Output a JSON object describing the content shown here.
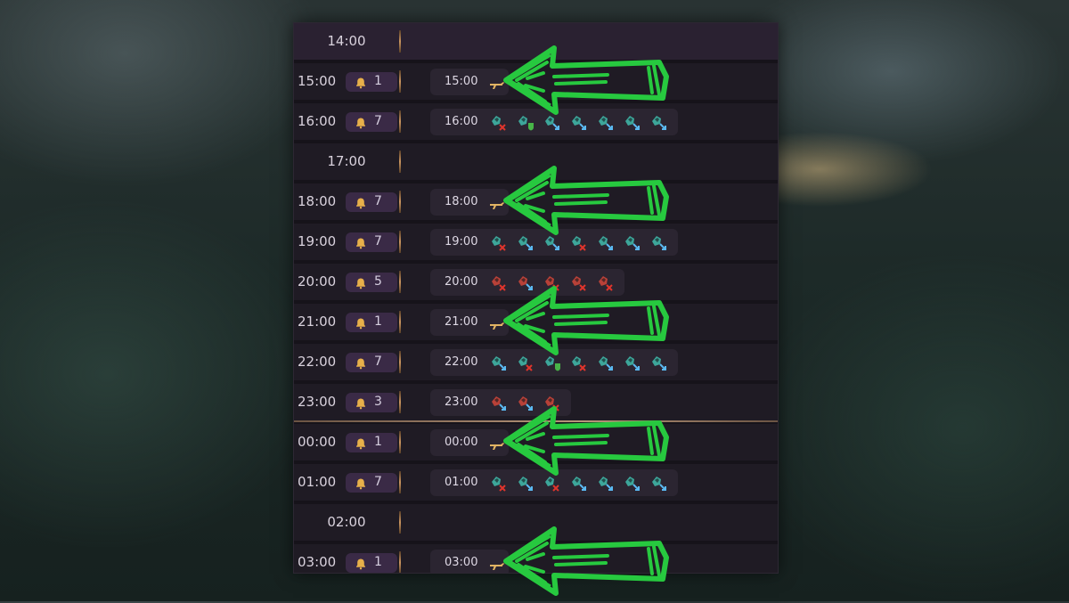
{
  "rows": [
    {
      "time": "14:00",
      "kind": "header"
    },
    {
      "time": "15:00",
      "count": "1",
      "card_time": "15:00",
      "rifle": true,
      "icons": []
    },
    {
      "time": "16:00",
      "count": "7",
      "card_time": "16:00",
      "rifle": false,
      "icons": [
        "teal-x",
        "teal-shield",
        "teal-arrow",
        "teal-arrow",
        "teal-arrow",
        "teal-arrow",
        "teal-arrow"
      ]
    },
    {
      "time": "17:00",
      "kind": "empty"
    },
    {
      "time": "18:00",
      "count": "7",
      "card_time": "18:00",
      "rifle": true,
      "icons": []
    },
    {
      "time": "19:00",
      "count": "7",
      "card_time": "19:00",
      "rifle": false,
      "icons": [
        "teal-x",
        "teal-arrow",
        "teal-arrow",
        "teal-x",
        "teal-arrow",
        "teal-arrow",
        "teal-arrow"
      ]
    },
    {
      "time": "20:00",
      "count": "5",
      "card_time": "20:00",
      "rifle": false,
      "icons": [
        "red-x",
        "red-arrow",
        "red-x",
        "red-x",
        "red-x"
      ]
    },
    {
      "time": "21:00",
      "count": "1",
      "card_time": "21:00",
      "rifle": true,
      "icons": []
    },
    {
      "time": "22:00",
      "count": "7",
      "card_time": "22:00",
      "rifle": false,
      "icons": [
        "teal-arrow",
        "teal-x",
        "teal-shield",
        "teal-x",
        "teal-arrow",
        "teal-arrow",
        "teal-arrow"
      ]
    },
    {
      "time": "23:00",
      "count": "3",
      "card_time": "23:00",
      "rifle": false,
      "icons": [
        "red-arrow",
        "red-arrow",
        "red-x"
      ]
    },
    {
      "time": "00:00",
      "count": "1",
      "card_time": "00:00",
      "rifle": true,
      "icons": []
    },
    {
      "time": "01:00",
      "count": "7",
      "card_time": "01:00",
      "rifle": false,
      "icons": [
        "teal-x",
        "teal-arrow",
        "teal-x",
        "teal-arrow",
        "teal-arrow",
        "teal-arrow",
        "teal-arrow"
      ]
    },
    {
      "time": "02:00",
      "kind": "empty"
    },
    {
      "time": "03:00",
      "count": "1",
      "card_time": "03:00",
      "rifle": true,
      "icons": []
    }
  ],
  "colors": {
    "teal": "#3fb5a6",
    "red": "#c8453a",
    "accent_gold": "#c99560",
    "annotation_green": "#27c93f"
  }
}
